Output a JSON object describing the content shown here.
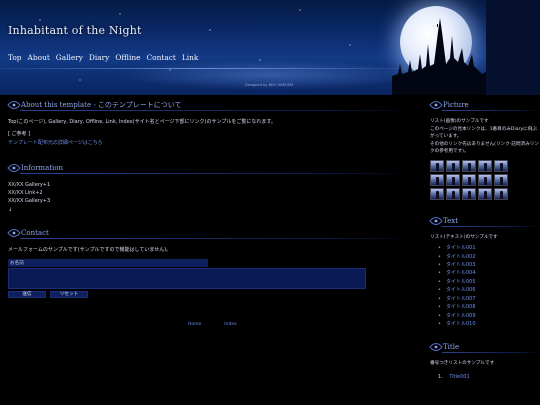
{
  "header": {
    "site_title": "Inhabitant of the Night",
    "nav": [
      "Top",
      "About",
      "Gallery",
      "Diary",
      "Offline",
      "Contact",
      "Link"
    ],
    "designed_by": "Designed by NEO HIMEISM"
  },
  "main": {
    "about": {
      "title": "About this template - このテンプレートについて",
      "line1": "Top(このページ), Gallery, Diary, Offline, Link, Index(サイト名とページ下部にリンク)のサンプルをご覧になれます。",
      "note_label": "[ ご参考 ]",
      "note_link": "テンプレート配布元の詳細ページはこちら"
    },
    "information": {
      "title": "Information",
      "items": [
        "XX/XX Gallery+1",
        "XX/XX Link+2",
        "XX/XX Gallery+3",
        "↓"
      ]
    },
    "contact": {
      "title": "Contact",
      "desc": "メールフォームのサンプルです(サンプルですので機能はしていません)。",
      "name_label": "お名前",
      "submit": "送信",
      "reset": "リセット"
    },
    "footer": [
      "Home",
      "Index"
    ]
  },
  "side": {
    "picture": {
      "title": "Picture",
      "desc1": "リスト(画像)のサンプルです",
      "desc2": "このページの見本リンクは、1番目のみDiaryに飛ぶがっています。",
      "desc3": "その他のリンク先はありません(リンク-訪問済みリンクの参考用です)。"
    },
    "text": {
      "title": "Text",
      "desc": "リスト(テキスト)のサンプルです",
      "items": [
        "タイトル001",
        "タイトル002",
        "タイトル003",
        "タイトル004",
        "タイトル005",
        "タイトル006",
        "タイトル007",
        "タイトル008",
        "タイトル009",
        "タイトル010"
      ]
    },
    "title_section": {
      "title": "Title",
      "desc": "番号つきリストのサンプルです",
      "first_item": "Title001"
    }
  }
}
